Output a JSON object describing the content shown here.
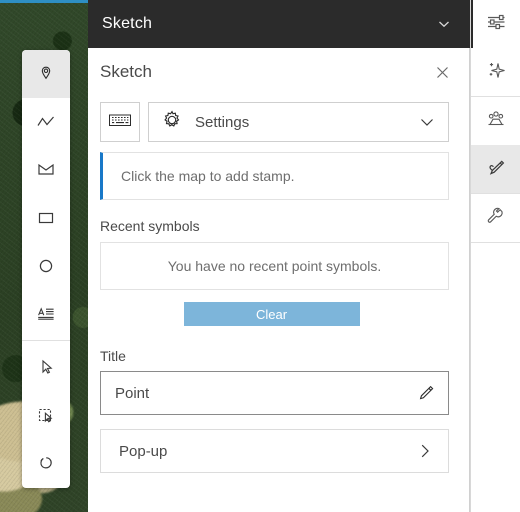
{
  "window": {
    "titlebar_title": "Sketch",
    "titlebar_collapse_icon": "chevron-down-icon"
  },
  "panel": {
    "title": "Sketch",
    "close_icon": "close-icon",
    "keyboard_button_icon": "keyboard-icon",
    "settings": {
      "icon": "gear-icon",
      "label": "Settings",
      "chevron_icon": "chevron-down-icon"
    },
    "notice": {
      "text": "Click the map to add stamp.",
      "accent_color": "#1878c8"
    },
    "recent_symbols": {
      "label": "Recent symbols",
      "empty_text": "You have no recent point symbols.",
      "clear_label": "Clear",
      "clear_color": "#7db5da"
    },
    "title_field": {
      "label": "Title",
      "value": "Point",
      "edit_icon": "pencil-icon"
    },
    "popup": {
      "label": "Pop-up",
      "chevron_icon": "chevron-right-icon"
    },
    "scrollbar": {
      "up_arrow_icon": "caret-up-icon"
    }
  },
  "sketch_tools": [
    {
      "name": "point-tool",
      "icon": "map-pin-icon",
      "active": true
    },
    {
      "name": "polyline-tool",
      "icon": "polyline-icon",
      "active": false
    },
    {
      "name": "polygon-tool",
      "icon": "polygon-icon",
      "active": false
    },
    {
      "name": "rectangle-tool",
      "icon": "rectangle-icon",
      "active": false
    },
    {
      "name": "circle-tool",
      "icon": "circle-icon",
      "active": false
    },
    {
      "name": "text-tool",
      "icon": "text-icon",
      "active": false
    },
    {
      "name": "select-tool",
      "icon": "cursor-arrow-icon",
      "active": false
    },
    {
      "name": "box-select-tool",
      "icon": "marquee-select-icon",
      "active": false
    },
    {
      "name": "lasso-tool",
      "icon": "lasso-icon",
      "active": false
    }
  ],
  "right_rail": [
    {
      "name": "properties-button",
      "icon": "sliders-icon",
      "active": false
    },
    {
      "name": "effects-button",
      "icon": "sparkle-icon",
      "active": false
    },
    {
      "name": "share-button",
      "icon": "group-icon",
      "active": false
    },
    {
      "name": "sketch-button",
      "icon": "pencil-icon",
      "active": true
    },
    {
      "name": "settings-button",
      "icon": "wrench-icon",
      "active": false
    }
  ],
  "map": {
    "basemap_type": "satellite-imagery"
  }
}
